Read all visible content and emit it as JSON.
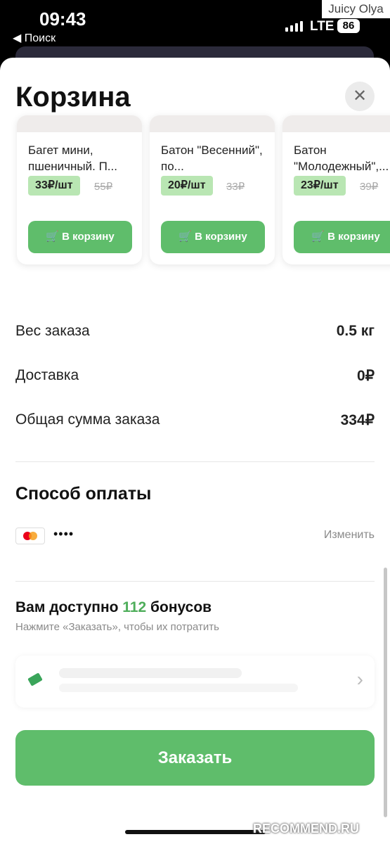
{
  "status_bar": {
    "time": "09:43",
    "back_label": "◀ Поиск",
    "network": "LTE",
    "battery": "86",
    "overlay_user": "Juicy Olya"
  },
  "cart": {
    "title": "Корзина",
    "close_glyph": "✕"
  },
  "products": [
    {
      "name": "Багет мини, пшеничный. П...",
      "price": "33₽/шт",
      "old_price": "55₽",
      "button": "В корзину"
    },
    {
      "name": "Батон \"Весенний\", по...",
      "price": "20₽/шт",
      "old_price": "33₽",
      "button": "В корзину"
    },
    {
      "name": "Батон \"Молодежный\",...",
      "price": "23₽/шт",
      "old_price": "39₽",
      "button": "В корзину"
    }
  ],
  "summary": {
    "weight_label": "Вес заказа",
    "weight_value": "0.5 кг",
    "delivery_label": "Доставка",
    "delivery_value": "0₽",
    "total_label": "Общая сумма заказа",
    "total_value": "334₽"
  },
  "payment": {
    "title": "Способ оплаты",
    "card_mask": "••••",
    "change_label": "Изменить",
    "card_icon": "mastercard-icon"
  },
  "bonus": {
    "prefix": "Вам доступно ",
    "amount": "112",
    "suffix": " бонусов",
    "hint": "Нажмите «Заказать», чтобы их потратить"
  },
  "promo": {
    "arrow": "›"
  },
  "order_button": "Заказать",
  "watermark": "RECOMMEND.RU",
  "colors": {
    "accent_green": "#5fbd6b",
    "price_badge": "#b9e6b3",
    "bonus_green": "#4fae5b"
  }
}
